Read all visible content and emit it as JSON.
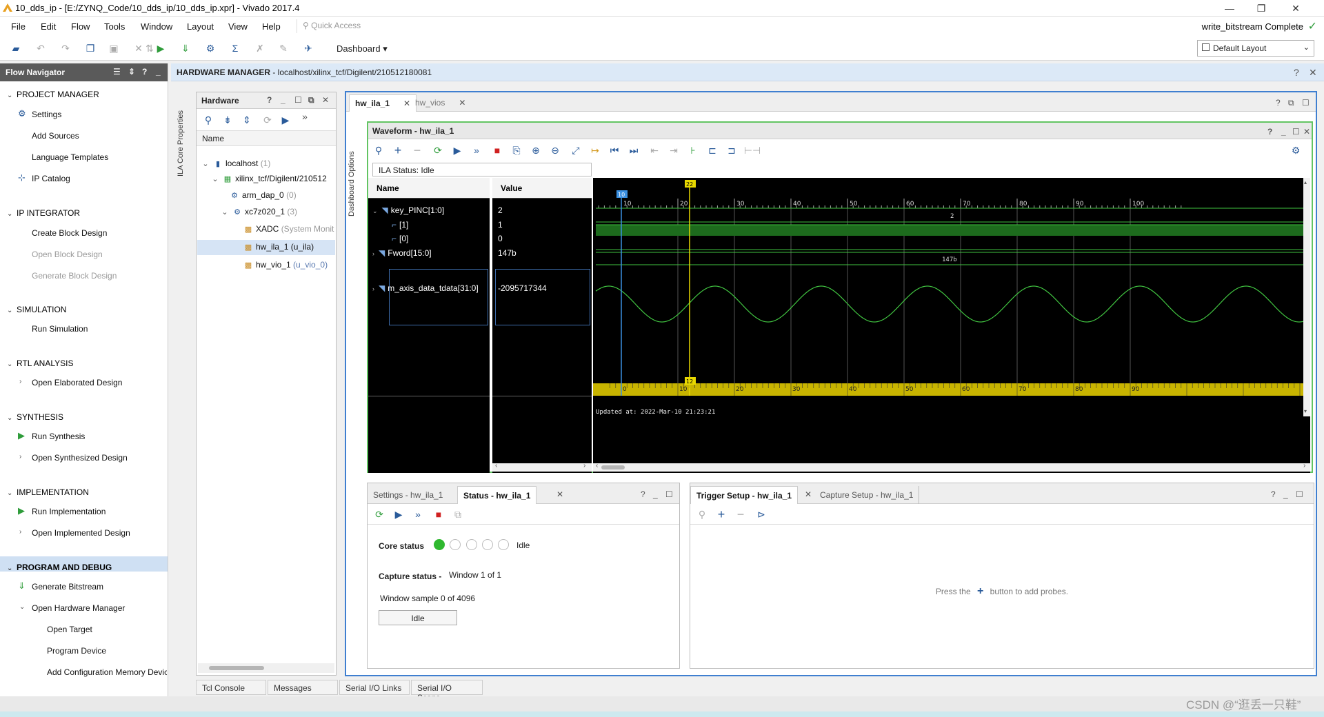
{
  "window": {
    "title": "10_dds_ip - [E:/ZYNQ_Code/10_dds_ip/10_dds_ip.xpr] - Vivado 2017.4",
    "minimize": "—",
    "restore": "❐",
    "close": "✕"
  },
  "menu": {
    "items": [
      "File",
      "Edit",
      "Flow",
      "Tools",
      "Window",
      "Layout",
      "View",
      "Help"
    ],
    "quick_access_placeholder": "Quick Access",
    "status": "write_bitstream Complete"
  },
  "toolbar": {
    "dashboard_label": "Dashboard",
    "layout_value": "Default Layout"
  },
  "flow_navigator": {
    "title": "Flow Navigator",
    "sections": [
      {
        "label": "PROJECT MANAGER",
        "items": [
          {
            "label": "Settings",
            "icon": "gear-icon",
            "disabled": false
          },
          {
            "label": "Add Sources",
            "disabled": false
          },
          {
            "label": "Language Templates",
            "disabled": false
          },
          {
            "label": "IP Catalog",
            "icon": "ip-catalog-icon",
            "disabled": false
          }
        ]
      },
      {
        "label": "IP INTEGRATOR",
        "items": [
          {
            "label": "Create Block Design",
            "disabled": false
          },
          {
            "label": "Open Block Design",
            "disabled": true
          },
          {
            "label": "Generate Block Design",
            "disabled": true
          }
        ]
      },
      {
        "label": "SIMULATION",
        "items": [
          {
            "label": "Run Simulation",
            "disabled": false
          }
        ]
      },
      {
        "label": "RTL ANALYSIS",
        "items": [
          {
            "label": "Open Elaborated Design",
            "disabled": false
          }
        ]
      },
      {
        "label": "SYNTHESIS",
        "items": [
          {
            "label": "Run Synthesis",
            "disabled": false
          },
          {
            "label": "Open Synthesized Design",
            "disabled": false
          }
        ]
      },
      {
        "label": "IMPLEMENTATION",
        "items": [
          {
            "label": "Run Implementation",
            "disabled": false
          },
          {
            "label": "Open Implemented Design",
            "disabled": false
          }
        ]
      },
      {
        "label": "PROGRAM AND DEBUG",
        "items": [
          {
            "label": "Generate Bitstream",
            "disabled": false
          },
          {
            "label": "Open Hardware Manager",
            "disabled": false
          },
          {
            "label": "Open Target",
            "disabled": false
          },
          {
            "label": "Program Device",
            "disabled": false
          },
          {
            "label": "Add Configuration Memory Device",
            "disabled": false
          }
        ]
      }
    ]
  },
  "hardware_manager": {
    "title": "HARDWARE MANAGER",
    "target": "- localhost/xilinx_tcf/Digilent/210512180081",
    "side_tabs": [
      "ILA Core Properties",
      "Dashboard Options"
    ]
  },
  "hardware_panel": {
    "title": "Hardware",
    "column": "Name",
    "nodes": [
      {
        "label": "localhost",
        "count": "(1)"
      },
      {
        "label": "xilinx_tcf/Digilent/210512",
        "count": ""
      },
      {
        "label": "arm_dap_0",
        "count": "(0)"
      },
      {
        "label": "xc7z020_1",
        "count": "(3)"
      },
      {
        "label": "XADC",
        "count": "(System Monit"
      },
      {
        "label": "hw_ila_1",
        "count": "(u_ila)"
      },
      {
        "label": "hw_vio_1",
        "count": "(u_vio_0)"
      }
    ]
  },
  "main_tabs": [
    "hw_ila_1",
    "hw_vios"
  ],
  "waveform": {
    "title": "Waveform - hw_ila_1",
    "ila_status": "ILA Status:  Idle",
    "col_name": "Name",
    "col_value": "Value",
    "signals": [
      {
        "name": "key_PINC[1:0]",
        "value": "2"
      },
      {
        "name": "[1]",
        "value": "1"
      },
      {
        "name": "[0]",
        "value": "0"
      },
      {
        "name": "Fword[15:0]",
        "value": "147b"
      },
      {
        "name": "m_axis_data_tdata[31:0]",
        "value": "-2095717344"
      }
    ],
    "bus_label_key": "2",
    "bus_label_fword": "147b",
    "top_ticks": [
      "10",
      "20",
      "30",
      "40",
      "50",
      "60",
      "70",
      "80",
      "90",
      "100"
    ],
    "bottom_ticks": [
      "0",
      "10",
      "20",
      "30",
      "40",
      "50",
      "60",
      "70",
      "80",
      "90"
    ],
    "marker_blue": "10",
    "marker_yellow_top": "22",
    "marker_yellow_bottom": "12",
    "updated": "Updated at: 2022-Mar-10 21:23:21"
  },
  "status_panel": {
    "tabs": [
      "Settings - hw_ila_1",
      "Status - hw_ila_1"
    ],
    "core_status_label": "Core status",
    "core_status_value": "Idle",
    "capture_status_label": "Capture status -",
    "capture_status_value": "Window 1 of 1",
    "window_sample": "Window sample 0 of 4096",
    "idle_button": "Idle"
  },
  "trigger_panel": {
    "tabs": [
      "Trigger Setup - hw_ila_1",
      "Capture Setup - hw_ila_1"
    ],
    "hint_before": "Press the",
    "hint_after": "button to add probes."
  },
  "bottom_tabs": [
    "Tcl Console",
    "Messages",
    "Serial I/O Links",
    "Serial I/O Scans"
  ],
  "watermark": "CSDN @“逛丢一只鞋”"
}
